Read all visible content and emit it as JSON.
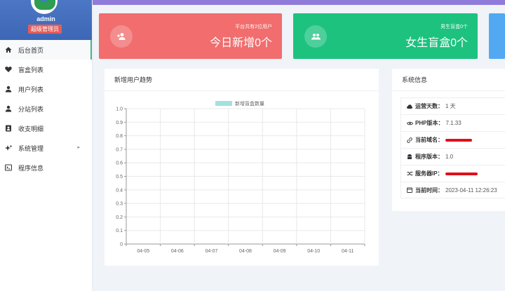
{
  "profile": {
    "username": "admin",
    "role": "超级管理员"
  },
  "nav": [
    {
      "label": "后台首页",
      "icon": "home-icon"
    },
    {
      "label": "盲盒列表",
      "icon": "heart-icon"
    },
    {
      "label": "用户列表",
      "icon": "user-icon"
    },
    {
      "label": "分站列表",
      "icon": "user-icon"
    },
    {
      "label": "收支明细",
      "icon": "contact-card-icon"
    },
    {
      "label": "系统管理",
      "icon": "sparkle-icon"
    },
    {
      "label": "程序信息",
      "icon": "terminal-icon"
    }
  ],
  "stats": [
    {
      "subtitle": "平台共有2位用户",
      "title": "今日新增0个",
      "color": "#f16d6e",
      "icon": "add-user-icon"
    },
    {
      "subtitle": "男生盲盒0个",
      "title": "女生盲盒0个",
      "color": "#1dc27f",
      "icon": "group-icon"
    }
  ],
  "chart_panel": {
    "title": "新增用户趋势"
  },
  "chart_data": {
    "type": "bar",
    "categories": [
      "04-05",
      "04-06",
      "04-07",
      "04-08",
      "04-09",
      "04-10",
      "04-11"
    ],
    "series": [
      {
        "name": "新增盲盒数量",
        "values": [
          0,
          0,
          0,
          0,
          0,
          0,
          0
        ],
        "color": "#a3e2dc"
      }
    ],
    "ylim": [
      0,
      1.0
    ],
    "yticks": [
      "1.0",
      "0.9",
      "0.8",
      "0.7",
      "0.6",
      "0.5",
      "0.4",
      "0.3",
      "0.2",
      "0.1",
      "0"
    ],
    "grid": true,
    "legend": "top-center"
  },
  "info_panel": {
    "title": "系统信息",
    "rows": [
      {
        "icon": "cloud-icon",
        "label": "运营天数：",
        "value": "1 天"
      },
      {
        "icon": "eye-icon",
        "label": "PHP版本：",
        "value": "7.1.33"
      },
      {
        "icon": "link-icon",
        "label": "当前域名：",
        "value": ""
      },
      {
        "icon": "android-icon",
        "label": "程序版本：",
        "value": "1.0"
      },
      {
        "icon": "shuffle-icon",
        "label": "服务器IP：",
        "value": ""
      },
      {
        "icon": "calendar-icon",
        "label": "当前时间：",
        "value": "2023-04-11 12:26:23"
      }
    ]
  }
}
